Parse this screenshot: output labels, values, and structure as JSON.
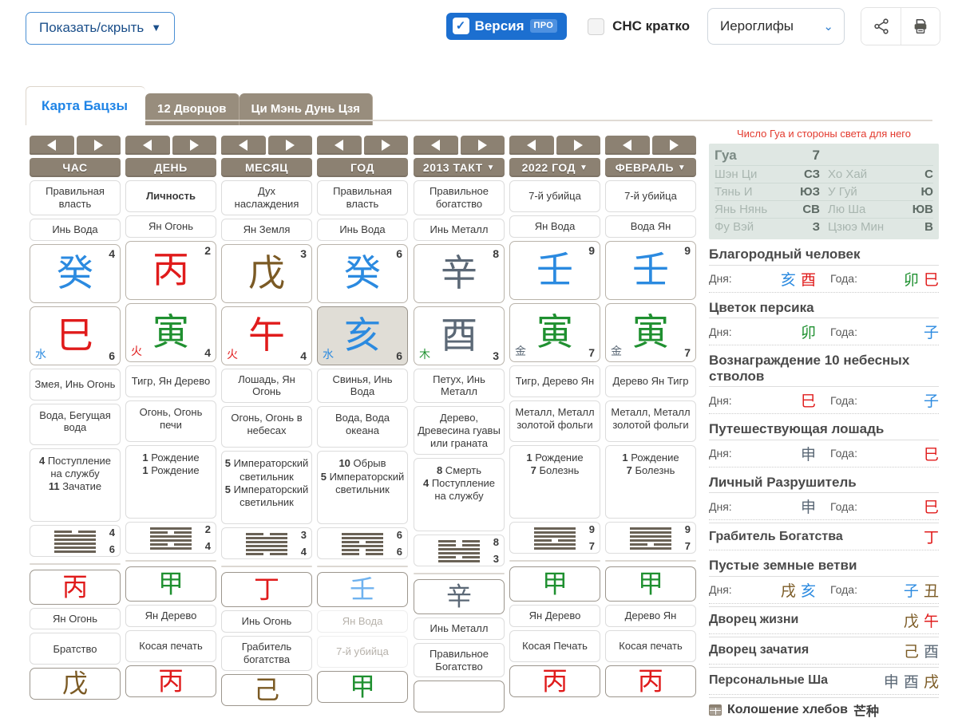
{
  "topbar": {
    "show_hide_label": "Показать/скрыть",
    "caret": "▼",
    "pro_label": "Версия",
    "pro_badge": "ПРО",
    "pro_check": "✓",
    "snc_label": "СНС кратко",
    "select_value": "Иероглифы",
    "select_chevron": "⌄",
    "share_icon": "share-icon",
    "print_icon": "print-icon"
  },
  "tabs": [
    {
      "label": "Карта Бацзы",
      "active": true
    },
    {
      "label": "12 Дворцов",
      "active": false
    },
    {
      "label": "Ци Мэнь Дунь Цзя",
      "active": false
    }
  ],
  "natal": {
    "columns": [
      {
        "header": "ЧАС",
        "ten_god": "Правильная власть",
        "stem_name": "Инь Вода",
        "stem_glyph": "癸",
        "stem_color": "water",
        "stem_num": "4",
        "branch_glyph": "巳",
        "branch_color": "fire",
        "branch_num": "6",
        "branch_elem": "水",
        "branch_elem_color": "water",
        "animal": "Змея, Инь Огонь",
        "napyin": "Вода, Бегущая вода",
        "stars": [
          "4 Поступление на службу",
          "11 Зачатие"
        ],
        "hex_top": "4",
        "hex_bottom": "6",
        "hex_lines": [
          "yin",
          "yang",
          "yang",
          "yang",
          "yang",
          "yang"
        ],
        "hidden": [
          {
            "glyph": "丙",
            "color": "fire",
            "name": "Ян Огонь",
            "god": "Братство",
            "muted": false
          },
          {
            "glyph": "戊",
            "color": "earth",
            "name": "",
            "god": "",
            "muted": false
          }
        ]
      },
      {
        "header": "ДЕНЬ",
        "ten_god": "Личность",
        "ten_god_bold": true,
        "stem_name": "Ян Огонь",
        "stem_glyph": "丙",
        "stem_color": "fire",
        "stem_num": "2",
        "branch_glyph": "寅",
        "branch_color": "wood",
        "branch_num": "4",
        "branch_elem": "火",
        "branch_elem_color": "fire",
        "animal": "Тигр, Ян Дерево",
        "napyin": "Огонь, Огонь печи",
        "stars": [
          "1 Рождение",
          "1 Рождение"
        ],
        "hex_top": "2",
        "hex_bottom": "4",
        "hex_lines": [
          "yang",
          "yin",
          "yang",
          "yang",
          "yin",
          "yang"
        ],
        "hidden": [
          {
            "glyph": "甲",
            "color": "wood",
            "name": "Ян Дерево",
            "god": "Косая печать",
            "muted": false
          },
          {
            "glyph": "丙",
            "color": "fire",
            "name": "",
            "god": "",
            "muted": false
          }
        ]
      },
      {
        "header": "МЕСЯЦ",
        "ten_god": "Дух наслаждения",
        "stem_name": "Ян Земля",
        "stem_glyph": "戊",
        "stem_color": "earth",
        "stem_num": "3",
        "branch_glyph": "午",
        "branch_color": "fire",
        "branch_num": "4",
        "branch_elem": "火",
        "branch_elem_color": "fire",
        "animal": "Лошадь, Ян Огонь",
        "napyin": "Огонь, Огонь в небесах",
        "stars": [
          "5 Императорский светильник",
          "5 Императорский светильник"
        ],
        "hex_top": "3",
        "hex_bottom": "4",
        "hex_lines": [
          "yin",
          "yang",
          "yang",
          "yang",
          "yang",
          "yin"
        ],
        "hidden": [
          {
            "glyph": "丁",
            "color": "fire",
            "name": "Инь Огонь",
            "god": "Грабитель богатства",
            "muted": false
          },
          {
            "glyph": "己",
            "color": "earth",
            "name": "",
            "god": "",
            "muted": false
          }
        ]
      },
      {
        "header": "ГОД",
        "ten_god": "Правильная власть",
        "stem_name": "Инь Вода",
        "stem_glyph": "癸",
        "stem_color": "water",
        "stem_num": "6",
        "branch_glyph": "亥",
        "branch_color": "water",
        "branch_num": "6",
        "branch_elem": "水",
        "branch_elem_color": "water",
        "branch_selected": true,
        "animal": "Свинья, Инь Вода",
        "napyin": "Вода, Вода океана",
        "stars": [
          "10 Обрыв",
          "5 Императорский светильник"
        ],
        "hex_top": "6",
        "hex_bottom": "6",
        "hex_lines": [
          "yang",
          "yang",
          "yin",
          "yang",
          "yin",
          "yin"
        ],
        "hidden": [
          {
            "glyph": "壬",
            "color": "water2",
            "name": "Ян Вода",
            "god": "7-й убийца",
            "muted": true
          },
          {
            "glyph": "甲",
            "color": "wood",
            "name": "",
            "god": "",
            "muted": true
          }
        ]
      }
    ]
  },
  "luck": {
    "columns": [
      {
        "header": "2013 ТАКТ",
        "header_caret": "▼",
        "ten_god": "Правильное богатство",
        "stem_name": "Инь Металл",
        "stem_glyph": "辛",
        "stem_color": "metal",
        "stem_num": "8",
        "branch_glyph": "酉",
        "branch_color": "metal",
        "branch_num": "3",
        "branch_elem": "木",
        "branch_elem_color": "wood",
        "animal": "Петух, Инь Металл",
        "napyin": "Дерево, Древесина гуавы или граната",
        "stars": [
          "8 Смерть",
          "4 Поступление на службу"
        ],
        "hex_top": "8",
        "hex_bottom": "3",
        "hex_lines": [
          "yin",
          "yin",
          "yang",
          "yang",
          "yin",
          "yang"
        ],
        "hidden": [
          {
            "glyph": "辛",
            "color": "metal",
            "name": "Инь Металл",
            "god": "Правильное Богатство",
            "muted": false
          },
          {
            "glyph": "",
            "color": "metal",
            "name": "",
            "god": "",
            "muted": false
          }
        ]
      },
      {
        "header": "2022 ГОД",
        "header_caret": "▼",
        "ten_god": "7-й убийца",
        "stem_name": "Ян Вода",
        "stem_glyph": "壬",
        "stem_color": "water",
        "stem_num": "9",
        "branch_glyph": "寅",
        "branch_color": "wood",
        "branch_num": "7",
        "branch_elem": "金",
        "branch_elem_color": "metal",
        "animal": "Тигр, Дерево Ян",
        "napyin": "Металл, Металл золотой фольги",
        "stars": [
          "1 Рождение",
          "7 Болезнь"
        ],
        "hex_top": "9",
        "hex_bottom": "7",
        "hex_lines": [
          "yang",
          "yang",
          "yang",
          "yin",
          "yang",
          "yang"
        ],
        "hidden": [
          {
            "glyph": "甲",
            "color": "wood",
            "name": "Ян Дерево",
            "god": "Косая Печать",
            "muted": false
          },
          {
            "glyph": "丙",
            "color": "fire",
            "name": "",
            "god": "",
            "muted": false
          }
        ]
      },
      {
        "header": "ФЕВРАЛЬ",
        "header_caret": "▼",
        "ten_god": "7-й убийца",
        "stem_name": "Вода Ян",
        "stem_glyph": "壬",
        "stem_color": "water",
        "stem_num": "9",
        "branch_glyph": "寅",
        "branch_color": "wood",
        "branch_num": "7",
        "branch_elem": "金",
        "branch_elem_color": "metal",
        "animal": "Дерево Ян Тигр",
        "napyin": "Металл, Металл золотой фольги",
        "stars": [
          "1 Рождение",
          "7 Болезнь"
        ],
        "hex_top": "9",
        "hex_bottom": "7",
        "hex_lines": [
          "yang",
          "yang",
          "yang",
          "yang",
          "yin",
          "yang"
        ],
        "hidden": [
          {
            "glyph": "甲",
            "color": "wood",
            "name": "Дерево Ян",
            "god": "Косая печать",
            "muted": false
          },
          {
            "glyph": "丙",
            "color": "fire",
            "name": "",
            "god": "",
            "muted": false
          }
        ]
      }
    ]
  },
  "sidebar": {
    "title": "Число Гуа и стороны света для него",
    "gua": {
      "label": "Гуа",
      "value": "7",
      "rows": [
        {
          "k": "Шэн Ци",
          "v": "СЗ",
          "k2": "Хо Хай",
          "v2": "С"
        },
        {
          "k": "Тянь И",
          "v": "ЮЗ",
          "k2": "У Гуй",
          "v2": "Ю"
        },
        {
          "k": "Янь Нянь",
          "v": "СВ",
          "k2": "Лю Ша",
          "v2": "ЮВ"
        },
        {
          "k": "Фу Вэй",
          "v": "З",
          "k2": "Цзюэ Мин",
          "v2": "В"
        }
      ]
    },
    "sections": [
      {
        "heading": "Благородный человек",
        "day_label": "Дня:",
        "day_glyphs": [
          {
            "t": "亥",
            "c": "water"
          },
          {
            "t": "酉",
            "c": "fire"
          }
        ],
        "year_label": "Года:",
        "year_glyphs": [
          {
            "t": "卯",
            "c": "wood"
          },
          {
            "t": "巳",
            "c": "fire"
          }
        ]
      },
      {
        "heading": "Цветок персика",
        "day_label": "Дня:",
        "day_glyphs": [
          {
            "t": "卯",
            "c": "wood"
          }
        ],
        "year_label": "Года:",
        "year_glyphs": [
          {
            "t": "子",
            "c": "water"
          }
        ]
      },
      {
        "heading": "Вознаграждение 10 небесных стволов",
        "day_label": "Дня:",
        "day_glyphs": [
          {
            "t": "巳",
            "c": "fire"
          }
        ],
        "year_label": "Года:",
        "year_glyphs": [
          {
            "t": "子",
            "c": "water"
          }
        ]
      },
      {
        "heading": "Путешествующая лошадь",
        "day_label": "Дня:",
        "day_glyphs": [
          {
            "t": "申",
            "c": "metal"
          }
        ],
        "year_label": "Года:",
        "year_glyphs": [
          {
            "t": "巳",
            "c": "fire"
          }
        ]
      },
      {
        "heading": "Личный Разрушитель",
        "day_label": "Дня:",
        "day_glyphs": [
          {
            "t": "申",
            "c": "metal"
          }
        ],
        "year_label": "Года:",
        "year_glyphs": [
          {
            "t": "巳",
            "c": "fire"
          }
        ]
      }
    ],
    "single_rows": [
      {
        "label": "Грабитель Богатства",
        "glyphs": [
          {
            "t": "丁",
            "c": "fire"
          }
        ]
      }
    ],
    "empty_branches": {
      "heading": "Пустые земные ветви",
      "day_label": "Дня:",
      "day_glyphs": [
        {
          "t": "戌",
          "c": "earth"
        },
        {
          "t": "亥",
          "c": "water"
        }
      ],
      "year_label": "Года:",
      "year_glyphs": [
        {
          "t": "子",
          "c": "water"
        },
        {
          "t": "丑",
          "c": "earth"
        }
      ]
    },
    "palace_rows": [
      {
        "label": "Дворец жизни",
        "glyphs": [
          {
            "t": "戊",
            "c": "earth"
          },
          {
            "t": "午",
            "c": "fire"
          }
        ]
      },
      {
        "label": "Дворец зачатия",
        "glyphs": [
          {
            "t": "己",
            "c": "earth"
          },
          {
            "t": "酉",
            "c": "metal"
          }
        ]
      },
      {
        "label": "Персональные Ша",
        "glyphs": [
          {
            "t": "申",
            "c": "metal"
          },
          {
            "t": "酉",
            "c": "metal"
          },
          {
            "t": "戌",
            "c": "earth"
          }
        ]
      }
    ],
    "solar_term": {
      "icon": "calendar-icon",
      "label": "Колошение хлебов",
      "glyph": "芒种"
    }
  }
}
